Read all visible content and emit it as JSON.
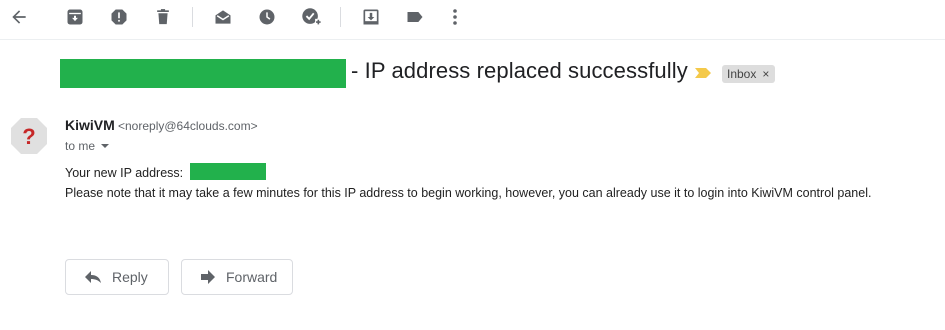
{
  "toolbar": {
    "icons": [
      "back-arrow-icon",
      "archive-icon",
      "report-spam-icon",
      "delete-icon",
      "mark-unread-icon",
      "snooze-icon",
      "add-to-tasks-icon",
      "move-to-icon",
      "labels-icon",
      "more-icon"
    ]
  },
  "email": {
    "subject": "- IP address replaced successfully",
    "label": "Inbox",
    "label_remove": "×",
    "sender_name": "KiwiVM",
    "sender_email": "<noreply@64clouds.com>",
    "recipient": "to me",
    "body_line1": "Your new IP address:",
    "body_line2": "Please note that it may take a few minutes for this IP address to begin working, however, you can already use it to login into KiwiVM control panel."
  },
  "actions": {
    "reply_label": "Reply",
    "forward_label": "Forward"
  },
  "colors": {
    "redaction": "#22b14c",
    "icon": "#5f6368",
    "importance_marker": "#f4c94a",
    "avatar_fill": "#e0e0e0",
    "avatar_glyph": "#c62828"
  }
}
